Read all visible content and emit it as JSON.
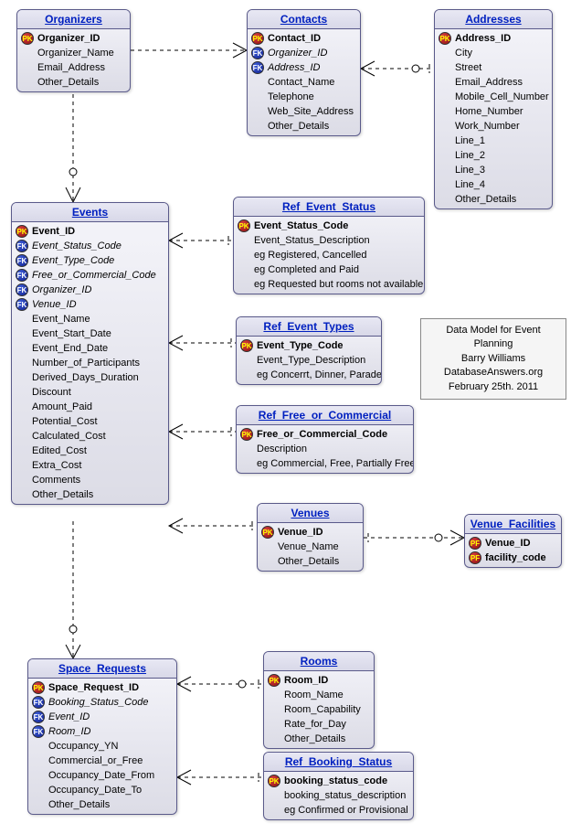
{
  "entities": {
    "organizers": {
      "title": "Organizers",
      "attrs": [
        {
          "key": "pk",
          "name": "Organizer_ID",
          "bold": true
        },
        {
          "key": "",
          "name": "Organizer_Name"
        },
        {
          "key": "",
          "name": "Email_Address"
        },
        {
          "key": "",
          "name": "Other_Details"
        }
      ]
    },
    "contacts": {
      "title": "Contacts",
      "attrs": [
        {
          "key": "pk",
          "name": "Contact_ID",
          "bold": true
        },
        {
          "key": "fk",
          "name": "Organizer_ID",
          "italic": true
        },
        {
          "key": "fk",
          "name": "Address_ID",
          "italic": true
        },
        {
          "key": "",
          "name": "Contact_Name"
        },
        {
          "key": "",
          "name": "Telephone"
        },
        {
          "key": "",
          "name": "Web_Site_Address"
        },
        {
          "key": "",
          "name": "Other_Details"
        }
      ]
    },
    "addresses": {
      "title": "Addresses",
      "attrs": [
        {
          "key": "pk",
          "name": "Address_ID",
          "bold": true
        },
        {
          "key": "",
          "name": "City"
        },
        {
          "key": "",
          "name": "Street"
        },
        {
          "key": "",
          "name": "Email_Address"
        },
        {
          "key": "",
          "name": "Mobile_Cell_Number"
        },
        {
          "key": "",
          "name": "Home_Number"
        },
        {
          "key": "",
          "name": "Work_Number"
        },
        {
          "key": "",
          "name": "Line_1"
        },
        {
          "key": "",
          "name": "Line_2"
        },
        {
          "key": "",
          "name": "Line_3"
        },
        {
          "key": "",
          "name": "Line_4"
        },
        {
          "key": "",
          "name": "Other_Details"
        }
      ]
    },
    "events": {
      "title": "Events",
      "attrs": [
        {
          "key": "pk",
          "name": "Event_ID",
          "bold": true
        },
        {
          "key": "fk",
          "name": "Event_Status_Code",
          "italic": true
        },
        {
          "key": "fk",
          "name": "Event_Type_Code",
          "italic": true
        },
        {
          "key": "fk",
          "name": "Free_or_Commercial_Code",
          "italic": true
        },
        {
          "key": "fk",
          "name": "Organizer_ID",
          "italic": true
        },
        {
          "key": "fk",
          "name": "Venue_ID",
          "italic": true
        },
        {
          "key": "",
          "name": "Event_Name"
        },
        {
          "key": "",
          "name": "Event_Start_Date"
        },
        {
          "key": "",
          "name": "Event_End_Date"
        },
        {
          "key": "",
          "name": "Number_of_Participants"
        },
        {
          "key": "",
          "name": "Derived_Days_Duration"
        },
        {
          "key": "",
          "name": "Discount"
        },
        {
          "key": "",
          "name": "Amount_Paid"
        },
        {
          "key": "",
          "name": "Potential_Cost"
        },
        {
          "key": "",
          "name": "Calculated_Cost"
        },
        {
          "key": "",
          "name": "Edited_Cost"
        },
        {
          "key": "",
          "name": "Extra_Cost"
        },
        {
          "key": "",
          "name": "Comments"
        },
        {
          "key": "",
          "name": "Other_Details"
        }
      ]
    },
    "ref_event_status": {
      "title": "Ref_Event_Status",
      "attrs": [
        {
          "key": "pk",
          "name": "Event_Status_Code",
          "bold": true
        },
        {
          "key": "",
          "name": "Event_Status_Description"
        },
        {
          "key": "",
          "name": "eg Registered, Cancelled"
        },
        {
          "key": "",
          "name": "eg Completed and Paid"
        },
        {
          "key": "",
          "name": "eg Requested but rooms not available"
        }
      ]
    },
    "ref_event_types": {
      "title": "Ref_Event_Types",
      "attrs": [
        {
          "key": "pk",
          "name": "Event_Type_Code",
          "bold": true
        },
        {
          "key": "",
          "name": "Event_Type_Description"
        },
        {
          "key": "",
          "name": "eg Concerrt, Dinner, Parade"
        }
      ]
    },
    "ref_free_commercial": {
      "title": "Ref_Free_or_Commercial",
      "attrs": [
        {
          "key": "pk",
          "name": "Free_or_Commercial_Code",
          "bold": true
        },
        {
          "key": "",
          "name": "Description"
        },
        {
          "key": "",
          "name": "eg Commercial, Free, Partially Free"
        }
      ]
    },
    "venues": {
      "title": "Venues",
      "attrs": [
        {
          "key": "pk",
          "name": "Venue_ID",
          "bold": true
        },
        {
          "key": "",
          "name": "Venue_Name"
        },
        {
          "key": "",
          "name": "Other_Details"
        }
      ]
    },
    "venue_facilities": {
      "title": "Venue_Facilities",
      "attrs": [
        {
          "key": "pf",
          "name": "Venue_ID",
          "bold": true
        },
        {
          "key": "pf",
          "name": "facility_code",
          "bold": true
        }
      ]
    },
    "space_requests": {
      "title": "Space_Requests",
      "attrs": [
        {
          "key": "pk",
          "name": "Space_Request_ID",
          "bold": true
        },
        {
          "key": "fk",
          "name": "Booking_Status_Code",
          "italic": true
        },
        {
          "key": "fk",
          "name": "Event_ID",
          "italic": true
        },
        {
          "key": "fk",
          "name": "Room_ID",
          "italic": true
        },
        {
          "key": "",
          "name": "Occupancy_YN"
        },
        {
          "key": "",
          "name": "Commercial_or_Free"
        },
        {
          "key": "",
          "name": "Occupancy_Date_From"
        },
        {
          "key": "",
          "name": "Occupancy_Date_To"
        },
        {
          "key": "",
          "name": "Other_Details"
        }
      ]
    },
    "rooms": {
      "title": "Rooms",
      "attrs": [
        {
          "key": "pk",
          "name": "Room_ID",
          "bold": true
        },
        {
          "key": "",
          "name": "Room_Name"
        },
        {
          "key": "",
          "name": "Room_Capability"
        },
        {
          "key": "",
          "name": "Rate_for_Day"
        },
        {
          "key": "",
          "name": "Other_Details"
        }
      ]
    },
    "ref_booking_status": {
      "title": "Ref_Booking_Status",
      "attrs": [
        {
          "key": "pk",
          "name": "booking_status_code",
          "bold": true
        },
        {
          "key": "",
          "name": "booking_status_description"
        },
        {
          "key": "",
          "name": "eg Confirmed or Provisional"
        }
      ]
    }
  },
  "note": {
    "line1": "Data Model for Event Planning",
    "line2": "Barry Williams",
    "line3": "DatabaseAnswers.org",
    "line4": "February 25th.  2011"
  }
}
